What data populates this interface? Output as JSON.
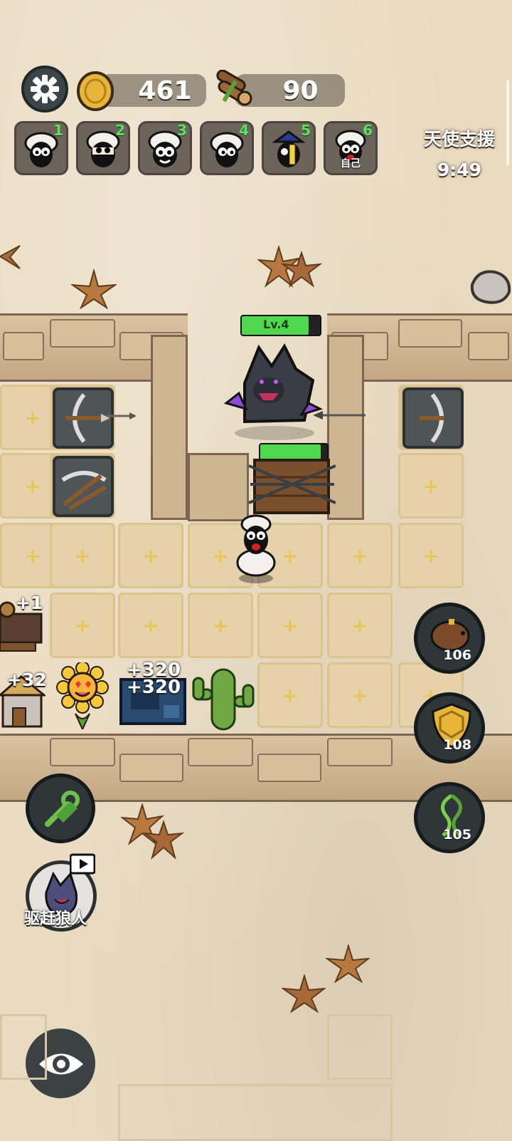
{
  "resources": {
    "gold": "461",
    "wood": "90"
  },
  "players": [
    {
      "num": "1"
    },
    {
      "num": "2"
    },
    {
      "num": "3"
    },
    {
      "num": "4"
    },
    {
      "num": "5"
    },
    {
      "num": "6",
      "tag": "自己"
    }
  ],
  "angel": {
    "title": "天使支援",
    "timer": "9:49"
  },
  "werewolf": {
    "level": "Lv.4",
    "health": 0.85
  },
  "gate": {
    "health": 0.9
  },
  "board": {
    "wood_gain": "+1",
    "house_gain": "+32",
    "machine_gain_a": "+320",
    "machine_gain_b": "+320"
  },
  "abilities": {
    "piggy_value": "106",
    "shield_value": "108",
    "vine_value": "105"
  },
  "drive_wolf_label": "驱赶狼人",
  "colors": {
    "hp_green": "#4fd84d",
    "accent_gold": "#e7b53a"
  }
}
